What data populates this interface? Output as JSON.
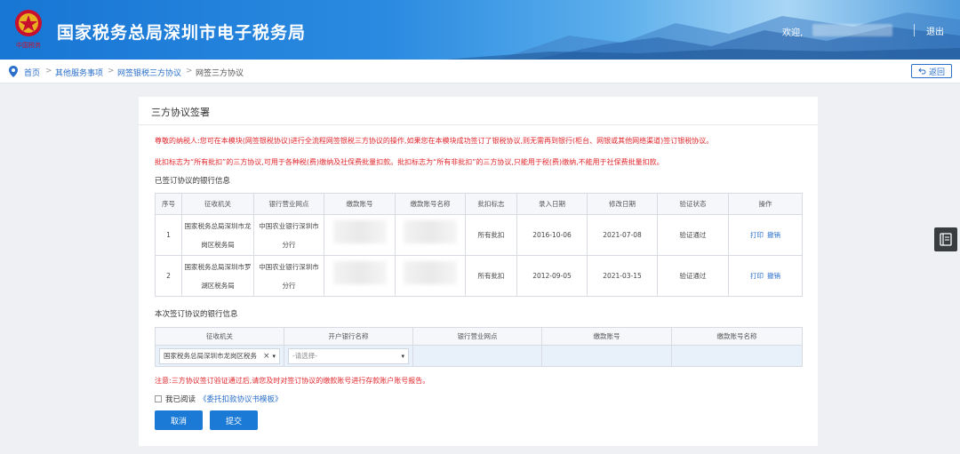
{
  "header": {
    "title": "国家税务总局深圳市电子税务局",
    "welcome": "欢迎,",
    "logout": "退出",
    "emblem_text": "中国税务"
  },
  "breadcrumb": {
    "items": [
      "首页",
      "其他服务事项",
      "网签银税三方协议",
      "网签三方协议"
    ],
    "separator": ">",
    "back_label": "返回"
  },
  "panel": {
    "title": "三方协议签署",
    "notice_1": "尊敬的纳税人:您可在本模块(网签银税协议)进行全流程网签银税三方协议的操作,如果您在本模块成功签订了银税协议,则无需再到银行(柜台、网银或其他网络渠道)签订银税协议。",
    "notice_2": "批扣标志为“所有批扣”的三方协议,可用于各种税(费)缴纳及社保费批量扣款。批扣标志为“所有非批扣”的三方协议,只能用于税(费)缴纳,不能用于社保费批量扣款。",
    "signed_section_label": "已签订协议的银行信息",
    "signed_table": {
      "headers": [
        "序号",
        "征收机关",
        "银行营业网点",
        "缴款账号",
        "缴款账号名称",
        "批扣标志",
        "录入日期",
        "修改日期",
        "验证状态",
        "操作"
      ],
      "rows": [
        {
          "no": "1",
          "authority": "国家税务总局深圳市龙岗区税务局",
          "branch": "中国农业银行深圳市分行",
          "account": "",
          "account_name": "",
          "batch": "所有批扣",
          "entry_date": "2016-10-06",
          "modify_date": "2021-07-08",
          "status": "验证通过",
          "op_print": "打印",
          "op_cancel": "撤销"
        },
        {
          "no": "2",
          "authority": "国家税务总局深圳市罗湖区税务局",
          "branch": "中国农业银行深圳市分行",
          "account": "",
          "account_name": "",
          "batch": "所有批扣",
          "entry_date": "2012-09-05",
          "modify_date": "2021-03-15",
          "status": "验证通过",
          "op_print": "打印",
          "op_cancel": "撤销"
        }
      ]
    },
    "new_section_label": "本次签订协议的银行信息",
    "new_table": {
      "headers": [
        "征收机关",
        "开户银行名称",
        "银行营业网点",
        "缴款账号",
        "缴款账号名称"
      ],
      "authority_value": "国家税务总局深圳市龙岗区税务",
      "bank_placeholder": "-请选择-"
    },
    "warning": "注意:三方协议签订验证通过后,请您及时对签订协议的缴款账号进行存款账户账号报告。",
    "agree_prefix": "我已阅读",
    "agree_link": "《委托扣款协议书模板》",
    "cancel_label": "取消",
    "submit_label": "提交"
  },
  "colors": {
    "primary": "#1a7ad6",
    "link": "#2a6fc9",
    "danger": "#e0262c"
  }
}
